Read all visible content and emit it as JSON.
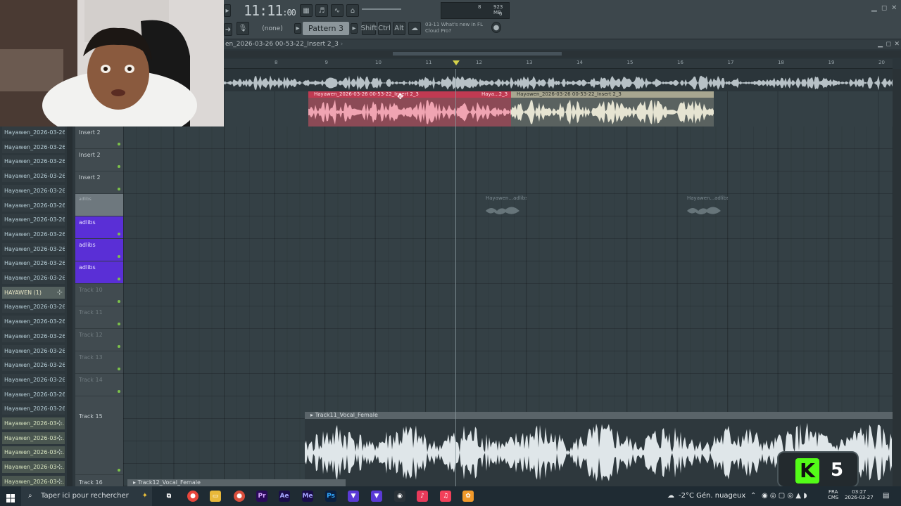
{
  "toolbar": {
    "time_main": "11:11",
    "time_sub": ":00",
    "pattern_selector": "(none)",
    "pattern_name": "Pattern 3",
    "shift_label": "Shift",
    "ctrl_label": "Ctrl",
    "alt_label": "Alt",
    "news_line1": "03-11  What's new in FL",
    "news_line2": "Cloud Pro?",
    "cpu_voices": "8",
    "mem": "923 MB",
    "cpu_zero": "0"
  },
  "playlist": {
    "title": "en_2026-03-26 00-53-22_Insert 2_3",
    "ruler_marks": [
      "8",
      "9",
      "10",
      "11",
      "12",
      "13",
      "14",
      "15",
      "16",
      "17",
      "18",
      "19",
      "20"
    ]
  },
  "clips": {
    "red": "Hayawen_2026-03-26 00-53-22_Insert 2_3",
    "red_short": "Haya...2_3",
    "cream": "Hayawen_2026-03-26 00-53-22_Insert 2_3",
    "adlibs_a": "Hayawen...adlibs",
    "adlibs_b": "Hayawen...adlibs",
    "female_a": "Track11_Vocal_Female",
    "female_b": "Track12_Vocal_Female"
  },
  "browser": {
    "items": [
      "Hayawen_2026-03-26 02...",
      "Hayawen_2026-03-26 02...",
      "Hayawen_2026-03-26 02...",
      "Hayawen_2026-03-26 02...",
      "Hayawen_2026-03-26 02...",
      "Hayawen_2026-03-26 02...",
      "Hayawen_2026-03-26 02...",
      "Hayawen_2026-03-26 02...",
      "Hayawen_2026-03-26 02...",
      "Hayawen_2026-03-26 02...",
      "Hayawen_2026-03-26 02...",
      "HAYAWEN (1)",
      "Hayawen_2026-03-26 02...",
      "Hayawen_2026-03-26 02...",
      "Hayawen_2026-03-26 02...",
      "Hayawen_2026-03-26 02...",
      "Hayawen_2026-03-26 02...",
      "Hayawen_2026-03-26 02...",
      "Hayawen_2026-03-26 02...",
      "Hayawen_2026-03-26 02...",
      "Hayawen_2026-03-...",
      "Hayawen_2026-03-...",
      "Hayawen_2026-03-...",
      "Hayawen_2026-03-...",
      "Hayawen_2026-03-..."
    ]
  },
  "tracks": {
    "t1": "Insert 2",
    "t2": "Insert 2",
    "t3": "Insert 2",
    "t4": "adlibs",
    "t5": "adlibs",
    "t6": "adlibs",
    "t7": "adlibs",
    "t8": "Track 10",
    "t9": "Track 11",
    "t10": "Track 12",
    "t11": "Track 13",
    "t12": "Track 14",
    "t13": "Track 15",
    "t14": "Track 16"
  },
  "overlay": {
    "kick_logo": "K",
    "kick_count": "5"
  },
  "taskbar": {
    "search_placeholder": "Taper ici pour rechercher",
    "weather": "-2°C  Gén. nuageux",
    "lang1": "FRA",
    "lang2": "CMS",
    "time": "03:27",
    "date": "2026-03-27",
    "apps": [
      "Ae",
      "Me",
      "Ps",
      "Pr"
    ]
  },
  "colors": {
    "accent_purple": "#5a2fd6",
    "clip_red": "#c03a52",
    "kick_green": "#53fc18"
  }
}
